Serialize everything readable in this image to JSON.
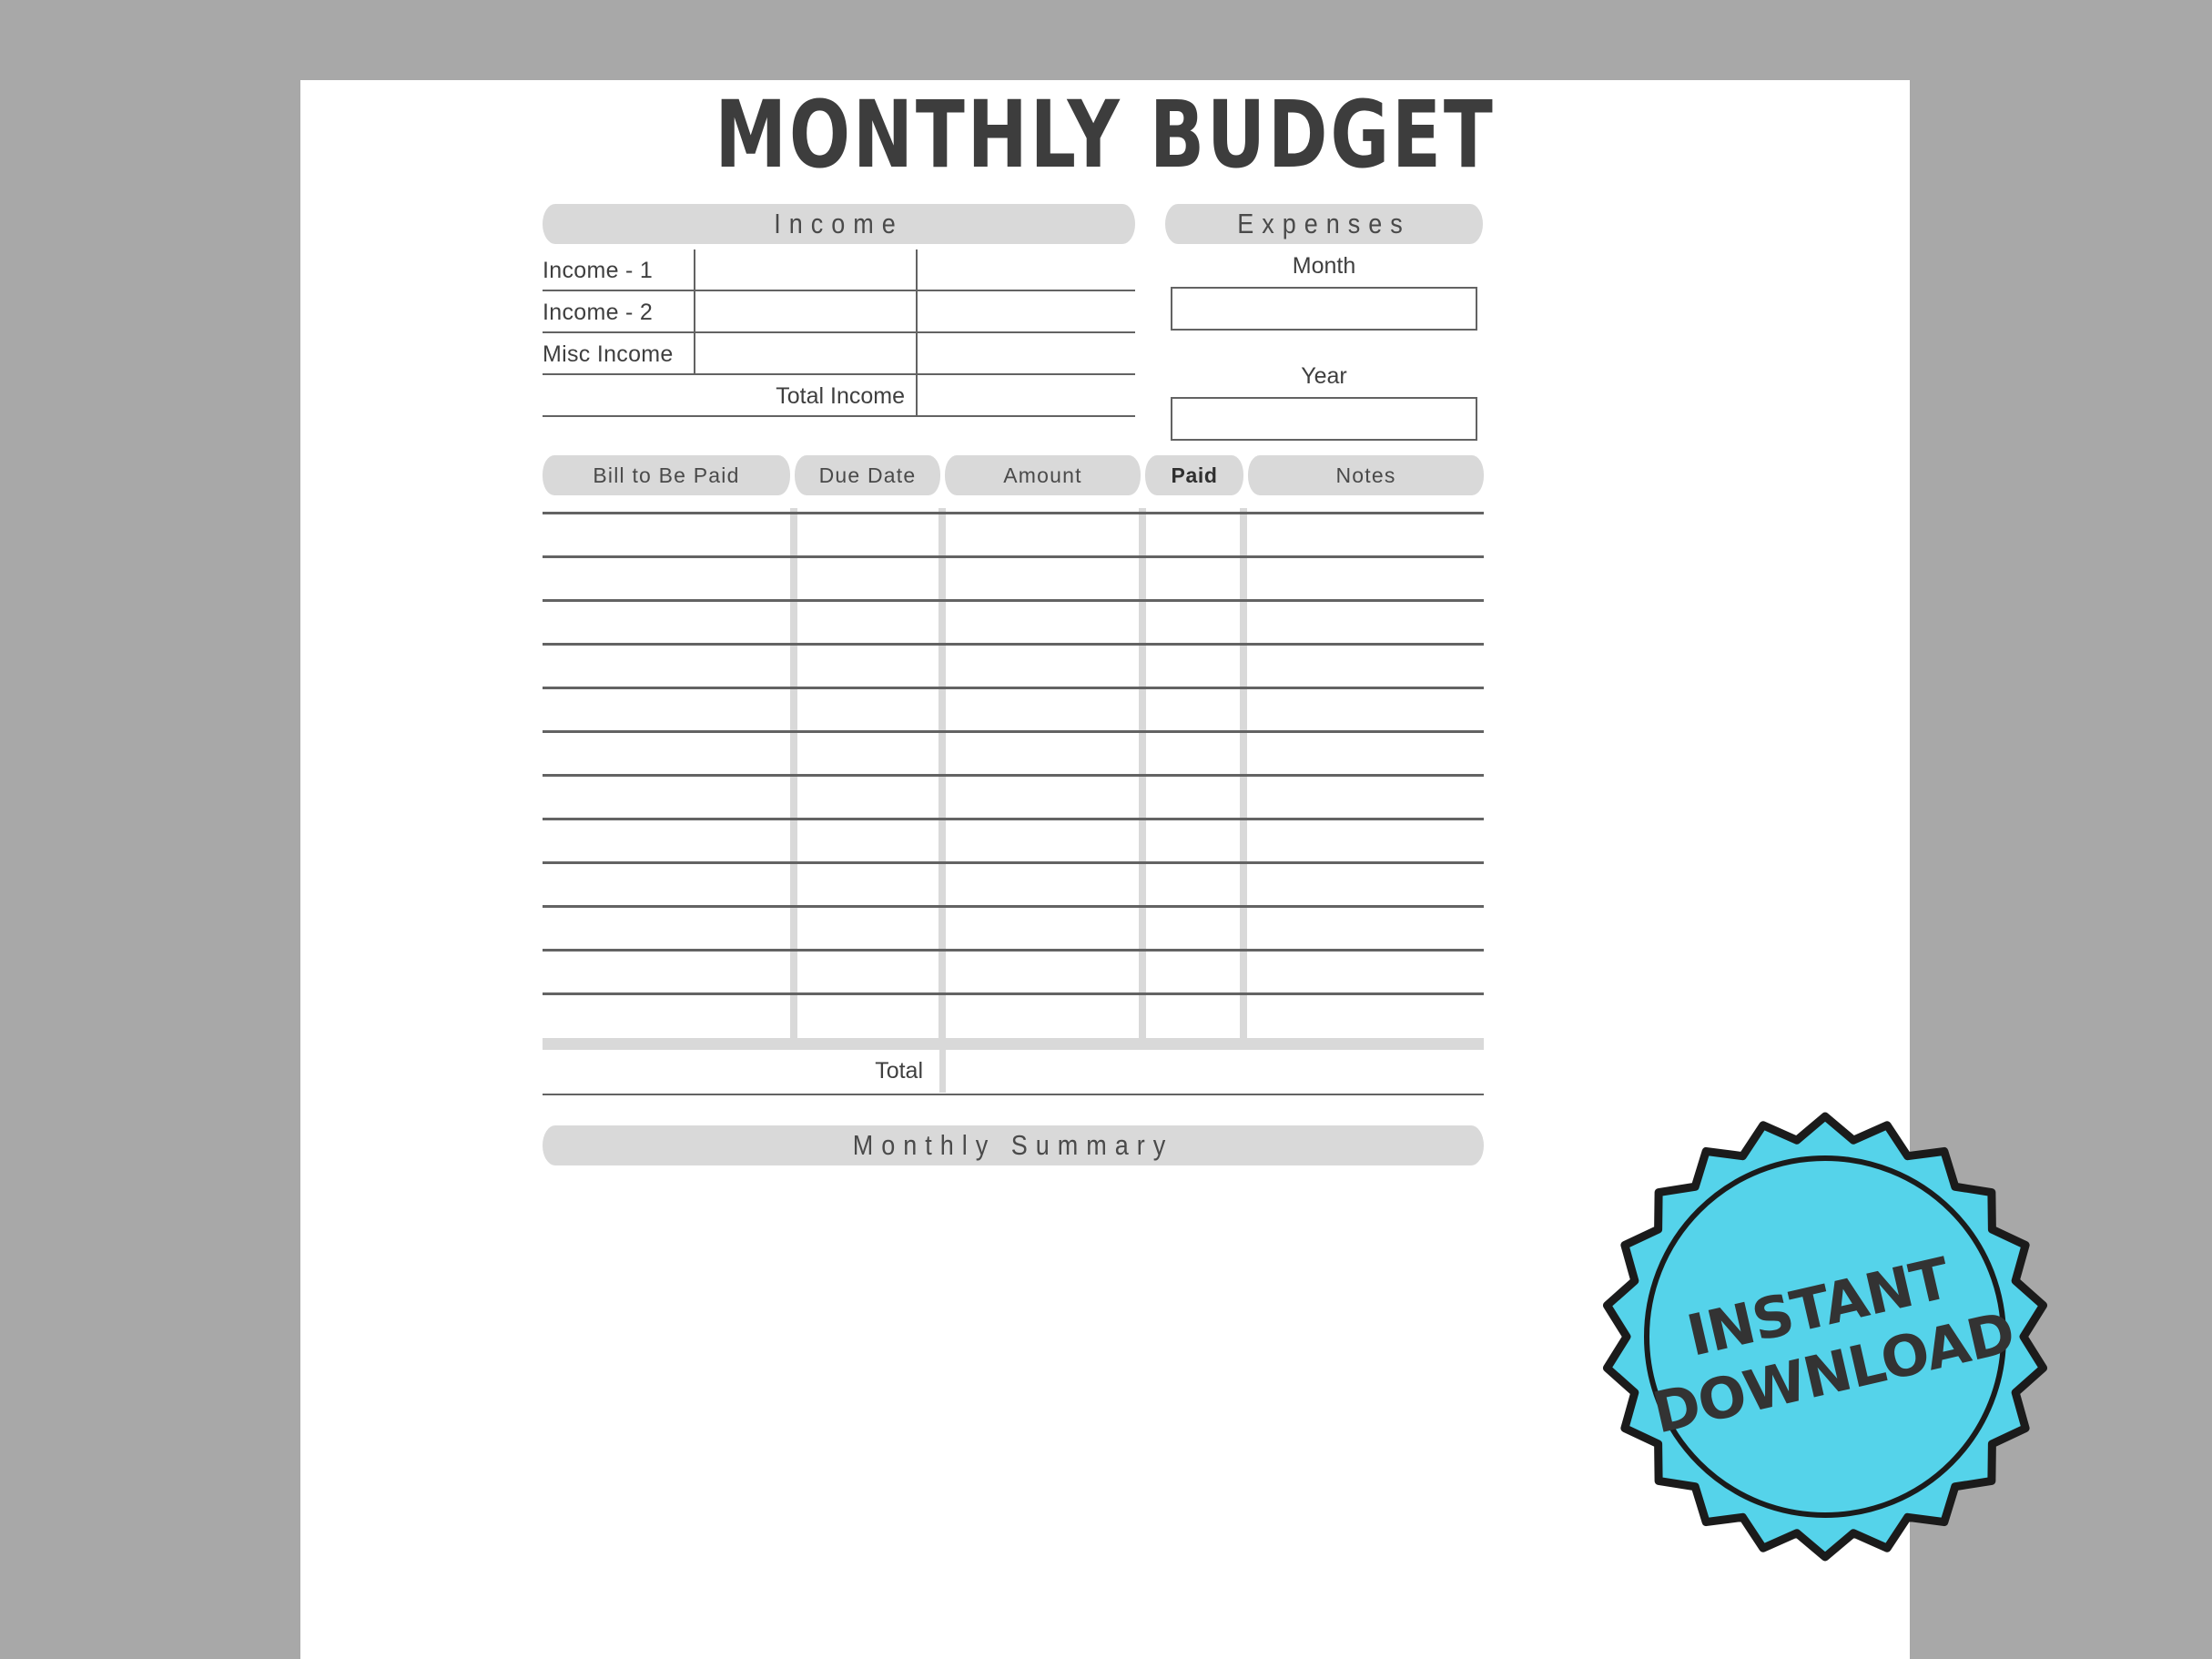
{
  "document": {
    "title": "MONTHLY BUDGET",
    "page_background": "#ffffff",
    "canvas_background": "#a8a8a8",
    "accent_color": "#55d3ea",
    "rule_color": "#636363",
    "pill_color": "#d9d9d9"
  },
  "income_section": {
    "heading": "Income",
    "rows": [
      {
        "label": "Income - 1",
        "amount": "",
        "note": ""
      },
      {
        "label": "Income - 2",
        "amount": "",
        "note": ""
      },
      {
        "label": "Misc Income",
        "amount": "",
        "note": ""
      }
    ],
    "total_label": "Total Income",
    "total_value": ""
  },
  "expenses_section": {
    "heading": "Expenses",
    "fields": [
      {
        "label": "Month",
        "value": "",
        "placeholder": ""
      },
      {
        "label": "Year",
        "value": "",
        "placeholder": ""
      }
    ]
  },
  "bills_table": {
    "columns": [
      {
        "label": "Bill to Be Paid",
        "emphasis": false
      },
      {
        "label": "Due Date",
        "emphasis": false
      },
      {
        "label": "Amount",
        "emphasis": false
      },
      {
        "label": "Paid",
        "emphasis": true
      },
      {
        "label": "Notes",
        "emphasis": false
      }
    ],
    "row_count": 12,
    "rows": [
      {
        "bill": "",
        "due_date": "",
        "amount": "",
        "paid": "",
        "notes": ""
      },
      {
        "bill": "",
        "due_date": "",
        "amount": "",
        "paid": "",
        "notes": ""
      },
      {
        "bill": "",
        "due_date": "",
        "amount": "",
        "paid": "",
        "notes": ""
      },
      {
        "bill": "",
        "due_date": "",
        "amount": "",
        "paid": "",
        "notes": ""
      },
      {
        "bill": "",
        "due_date": "",
        "amount": "",
        "paid": "",
        "notes": ""
      },
      {
        "bill": "",
        "due_date": "",
        "amount": "",
        "paid": "",
        "notes": ""
      },
      {
        "bill": "",
        "due_date": "",
        "amount": "",
        "paid": "",
        "notes": ""
      },
      {
        "bill": "",
        "due_date": "",
        "amount": "",
        "paid": "",
        "notes": ""
      },
      {
        "bill": "",
        "due_date": "",
        "amount": "",
        "paid": "",
        "notes": ""
      },
      {
        "bill": "",
        "due_date": "",
        "amount": "",
        "paid": "",
        "notes": ""
      },
      {
        "bill": "",
        "due_date": "",
        "amount": "",
        "paid": "",
        "notes": ""
      },
      {
        "bill": "",
        "due_date": "",
        "amount": "",
        "paid": "",
        "notes": ""
      }
    ],
    "total_label": "Total",
    "total_value": ""
  },
  "summary_section": {
    "heading": "Monthly Summary"
  },
  "badge": {
    "line1": "INSTANT",
    "line2": "DOWNLOAD",
    "fill_color": "#55d3ea",
    "outline_color": "#1b1b1b",
    "text_color": "#333333"
  }
}
